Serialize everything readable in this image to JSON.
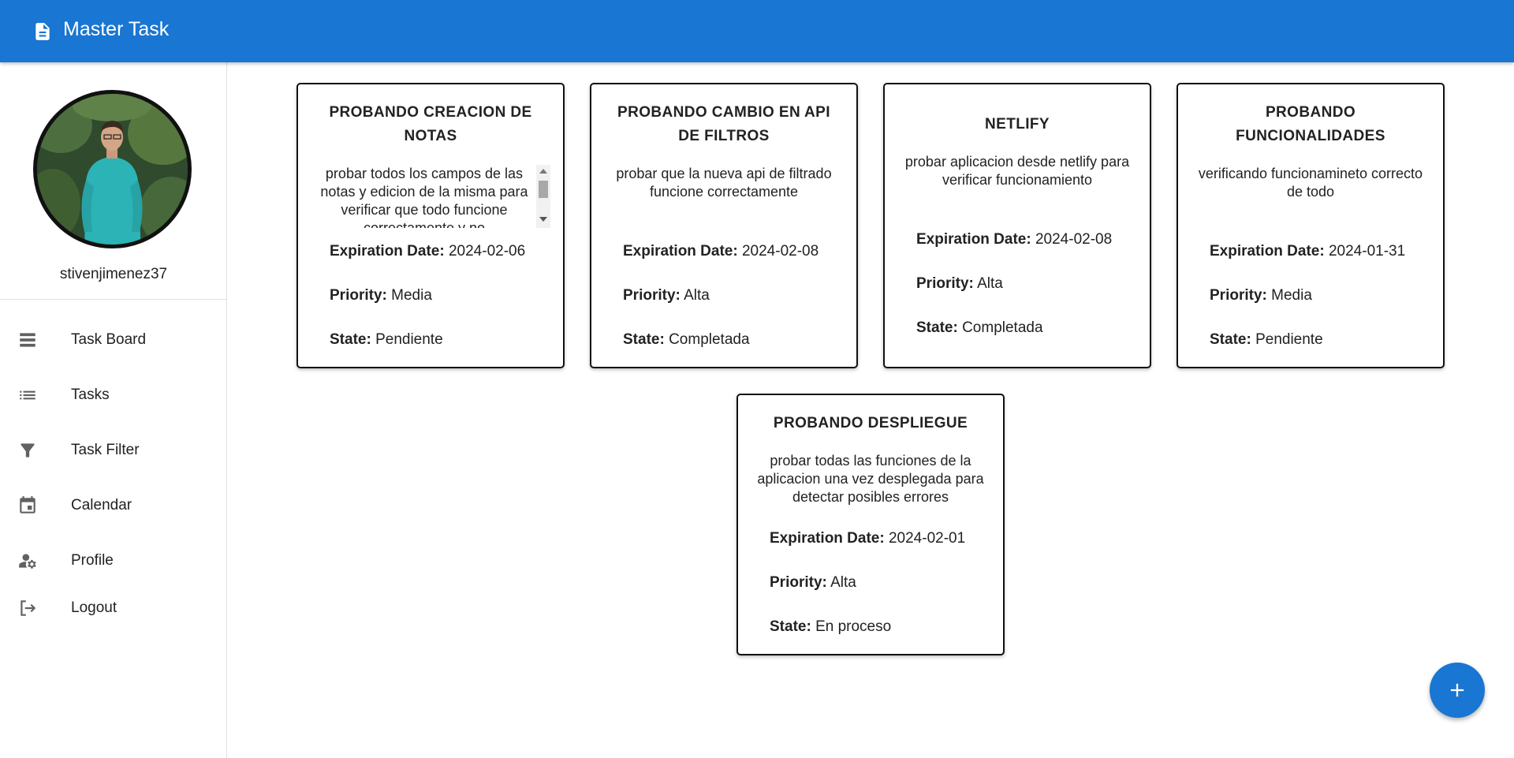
{
  "app": {
    "title": "Master Task"
  },
  "colors": {
    "primary": "#1976d2",
    "text": "#222222",
    "icon": "#616161"
  },
  "user": {
    "name": "stivenjimenez37"
  },
  "nav": [
    {
      "label": "Task Board",
      "icon": "view-list-icon"
    },
    {
      "label": "Tasks",
      "icon": "list-icon"
    },
    {
      "label": "Task Filter",
      "icon": "filter-icon"
    },
    {
      "label": "Calendar",
      "icon": "calendar-icon"
    },
    {
      "label": "Profile",
      "icon": "manage-account-icon"
    },
    {
      "label": "Logout",
      "icon": "logout-icon"
    }
  ],
  "labels": {
    "expiration": "Expiration Date:",
    "priority": "Priority:",
    "state": "State:"
  },
  "cards": [
    {
      "title": "PROBANDO CREACION DE NOTAS",
      "description": "probar todos los campos de las notas y edicion de la misma para verificar que todo funcione correctamente y no",
      "expiration": "2024-02-06",
      "priority": "Media",
      "state": "Pendiente"
    },
    {
      "title": "PROBANDO CAMBIO EN API DE FILTROS",
      "description": "probar que la nueva api de filtrado funcione correctamente",
      "expiration": "2024-02-08",
      "priority": "Alta",
      "state": "Completada"
    },
    {
      "title": "NETLIFY",
      "description": "probar aplicacion desde netlify para verificar funcionamiento",
      "expiration": "2024-02-08",
      "priority": "Alta",
      "state": "Completada"
    },
    {
      "title": "PROBANDO FUNCIONALIDADES",
      "description": "verificando funcionamineto correcto de todo",
      "expiration": "2024-01-31",
      "priority": "Media",
      "state": "Pendiente"
    },
    {
      "title": "PROBANDO DESPLIEGUE",
      "description": "probar todas las funciones de la aplicacion una vez desplegada para detectar posibles errores",
      "expiration": "2024-02-01",
      "priority": "Alta",
      "state": "En proceso"
    }
  ],
  "fab": {
    "icon": "add-icon"
  }
}
